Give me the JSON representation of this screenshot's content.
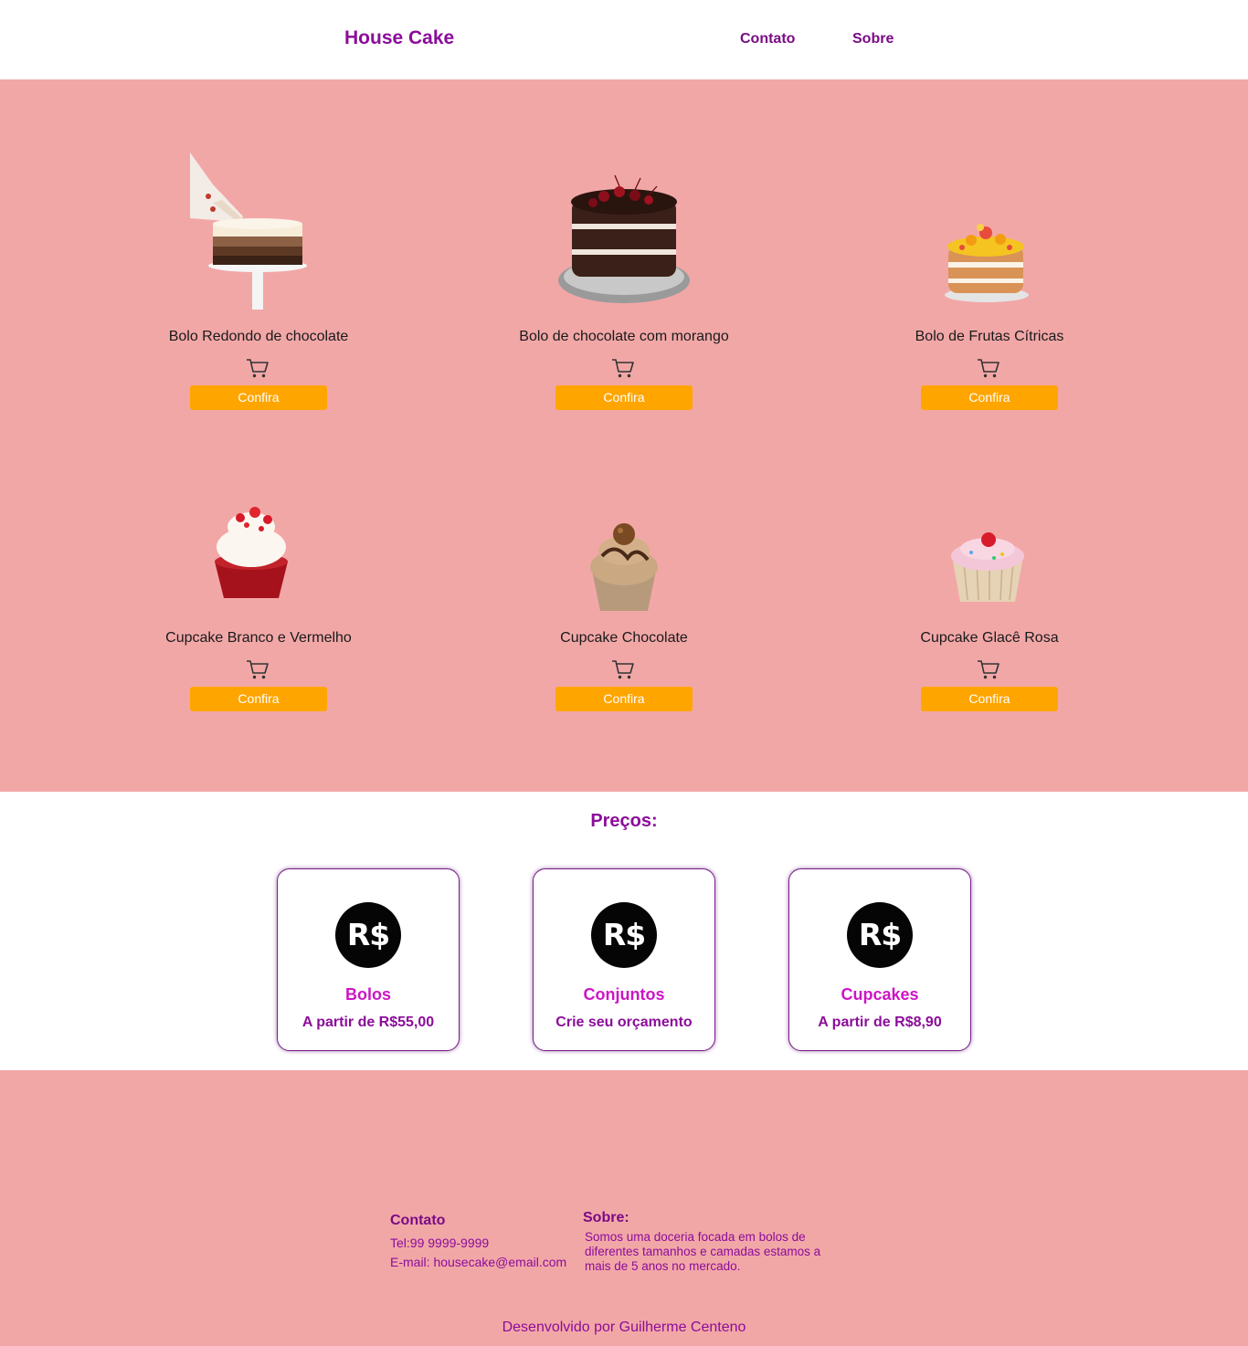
{
  "header": {
    "brand": "House Cake",
    "nav": [
      {
        "label": "Contato"
      },
      {
        "label": "Sobre"
      }
    ]
  },
  "products": [
    {
      "name": "Bolo Redondo de chocolate",
      "button": "Confira",
      "image": "layered-chocolate-cake-with-piping-bag"
    },
    {
      "name": "Bolo de chocolate com morango",
      "button": "Confira",
      "image": "chocolate-layer-cake-with-cherries"
    },
    {
      "name": "Bolo de Frutas Cítricas",
      "button": "Confira",
      "image": "citrus-fruit-layer-cake"
    },
    {
      "name": "Cupcake Branco e Vermelho",
      "button": "Confira",
      "image": "red-velvet-cupcake"
    },
    {
      "name": "Cupcake Chocolate",
      "button": "Confira",
      "image": "chocolate-cupcake"
    },
    {
      "name": "Cupcake Glacê Rosa",
      "button": "Confira",
      "image": "pink-frosted-cupcake"
    }
  ],
  "prices": {
    "title": "Preços:",
    "currency_symbol": "R$",
    "cards": [
      {
        "title": "Bolos",
        "subtitle": "A partir de R$55,00"
      },
      {
        "title": "Conjuntos",
        "subtitle": "Crie seu orçamento"
      },
      {
        "title": "Cupcakes",
        "subtitle": "A partir de R$8,90"
      }
    ]
  },
  "footer": {
    "contato_title": "Contato",
    "tel": "Tel:99 9999-9999",
    "email": "E-mail: housecake@email.com",
    "sobre_title": "Sobre:",
    "sobre_text": "Somos uma doceria focada em bolos de diferentes tamanhos e camadas estamos a mais de 5 anos no mercado.",
    "credit": "Desenvolvido por Guilherme Centeno"
  },
  "colors": {
    "accent_purple": "#8b0d9a",
    "pink_background": "#f2a7a7",
    "button_orange": "#ffa500",
    "card_title_magenta": "#cc16c4"
  }
}
